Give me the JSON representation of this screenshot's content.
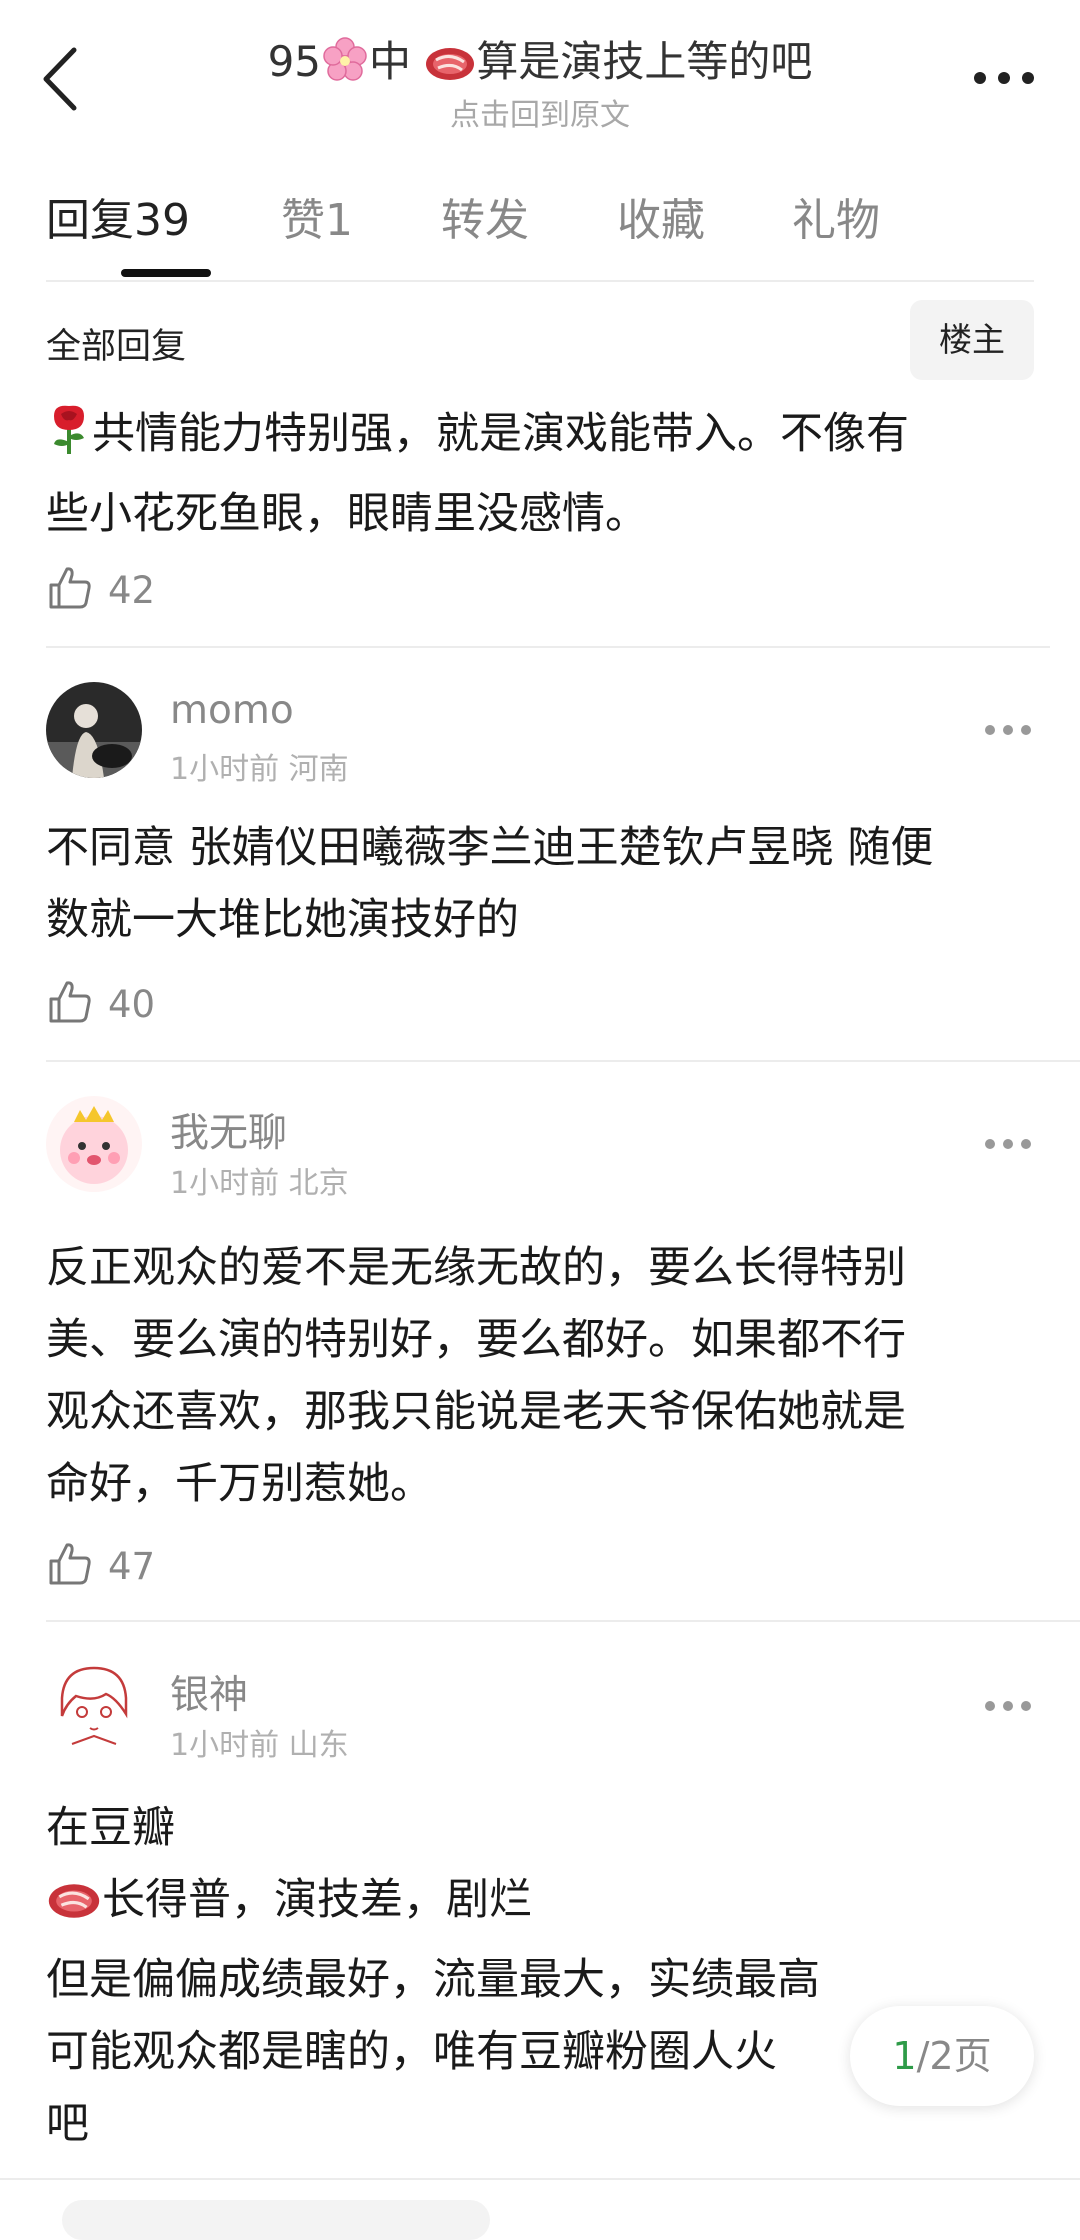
{
  "header": {
    "title_prefix": "95",
    "title_mid": "中 ",
    "title_suffix": "算是演技上等的吧",
    "subtitle": "点击回到原文"
  },
  "tabs": [
    {
      "label": "回复",
      "count": "39"
    },
    {
      "label": "赞",
      "count": "1"
    },
    {
      "label": "转发",
      "count": ""
    },
    {
      "label": "收藏",
      "count": ""
    },
    {
      "label": "礼物",
      "count": ""
    }
  ],
  "section": {
    "title": "全部回复",
    "filter_button": "楼主"
  },
  "comments": [
    {
      "lines": [
        "共情能力特别强，就是演戏能带入。不像有",
        "些小花死鱼眼，眼睛里没感情。"
      ],
      "likes": "42"
    },
    {
      "user": "momo",
      "time": "1小时前",
      "location": "河南",
      "lines": [
        "不同意 张婧仪田曦薇李兰迪王楚钦卢昱晓 随便",
        "数就一大堆比她演技好的"
      ],
      "likes": "40"
    },
    {
      "user": "我无聊",
      "time": "1小时前",
      "location": "北京",
      "lines": [
        "反正观众的爱不是无缘无故的，要么长得特别",
        "美、要么演的特别好，要么都好。如果都不行",
        "观众还喜欢，那我只能说是老天爷保佑她就是",
        "命好，千万别惹她。"
      ],
      "likes": "47"
    },
    {
      "user": "银神",
      "time": "1小时前",
      "location": "山东",
      "lines": [
        "在豆瓣",
        "长得普，演技差，剧烂",
        "但是偏偏成绩最好，流量最大，实绩最高",
        "可能观众都是瞎的，唯有豆瓣粉圈人火",
        "吧"
      ]
    }
  ],
  "pager": {
    "current": "1",
    "total": "/2页"
  },
  "colors": {
    "accent_green": "#2e9b48",
    "text_gray": "#888888"
  }
}
